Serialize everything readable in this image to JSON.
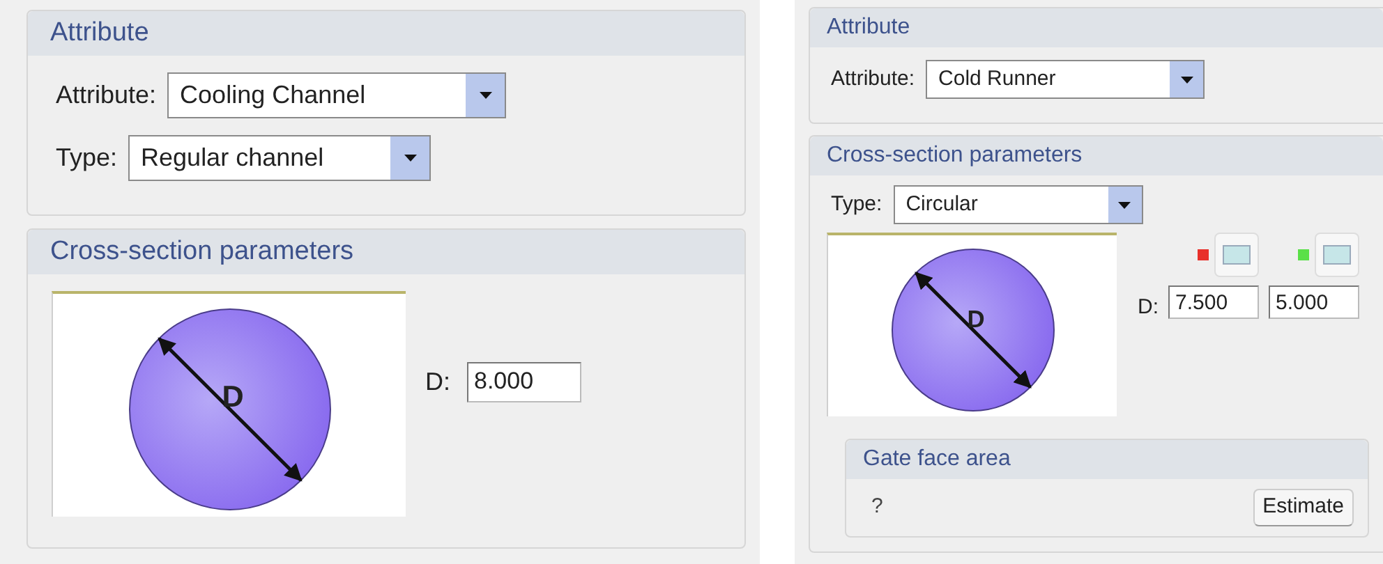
{
  "left_panel": {
    "attribute_section": {
      "title": "Attribute",
      "fields": [
        {
          "label": "Attribute:",
          "value": "Cooling Channel"
        },
        {
          "label": "Type:",
          "value": "Regular channel"
        }
      ]
    },
    "cross_section": {
      "title": "Cross-section parameters",
      "diagram_label": "D",
      "dimension": {
        "label": "D:",
        "value": "8.000"
      }
    }
  },
  "right_panel": {
    "attribute_section": {
      "title": "Attribute",
      "fields": [
        {
          "label": "Attribute:",
          "value": "Cold Runner"
        }
      ]
    },
    "cross_section": {
      "title": "Cross-section parameters",
      "type": {
        "label": "Type:",
        "value": "Circular"
      },
      "diagram_label": "D",
      "dimension_label": "D:",
      "stages": [
        {
          "color": "#e8302a",
          "value": "7.500"
        },
        {
          "color": "#5ae048",
          "value": "5.000"
        }
      ],
      "gate_face_area": {
        "title": "Gate face area",
        "value": "?",
        "button": "Estimate"
      }
    }
  }
}
